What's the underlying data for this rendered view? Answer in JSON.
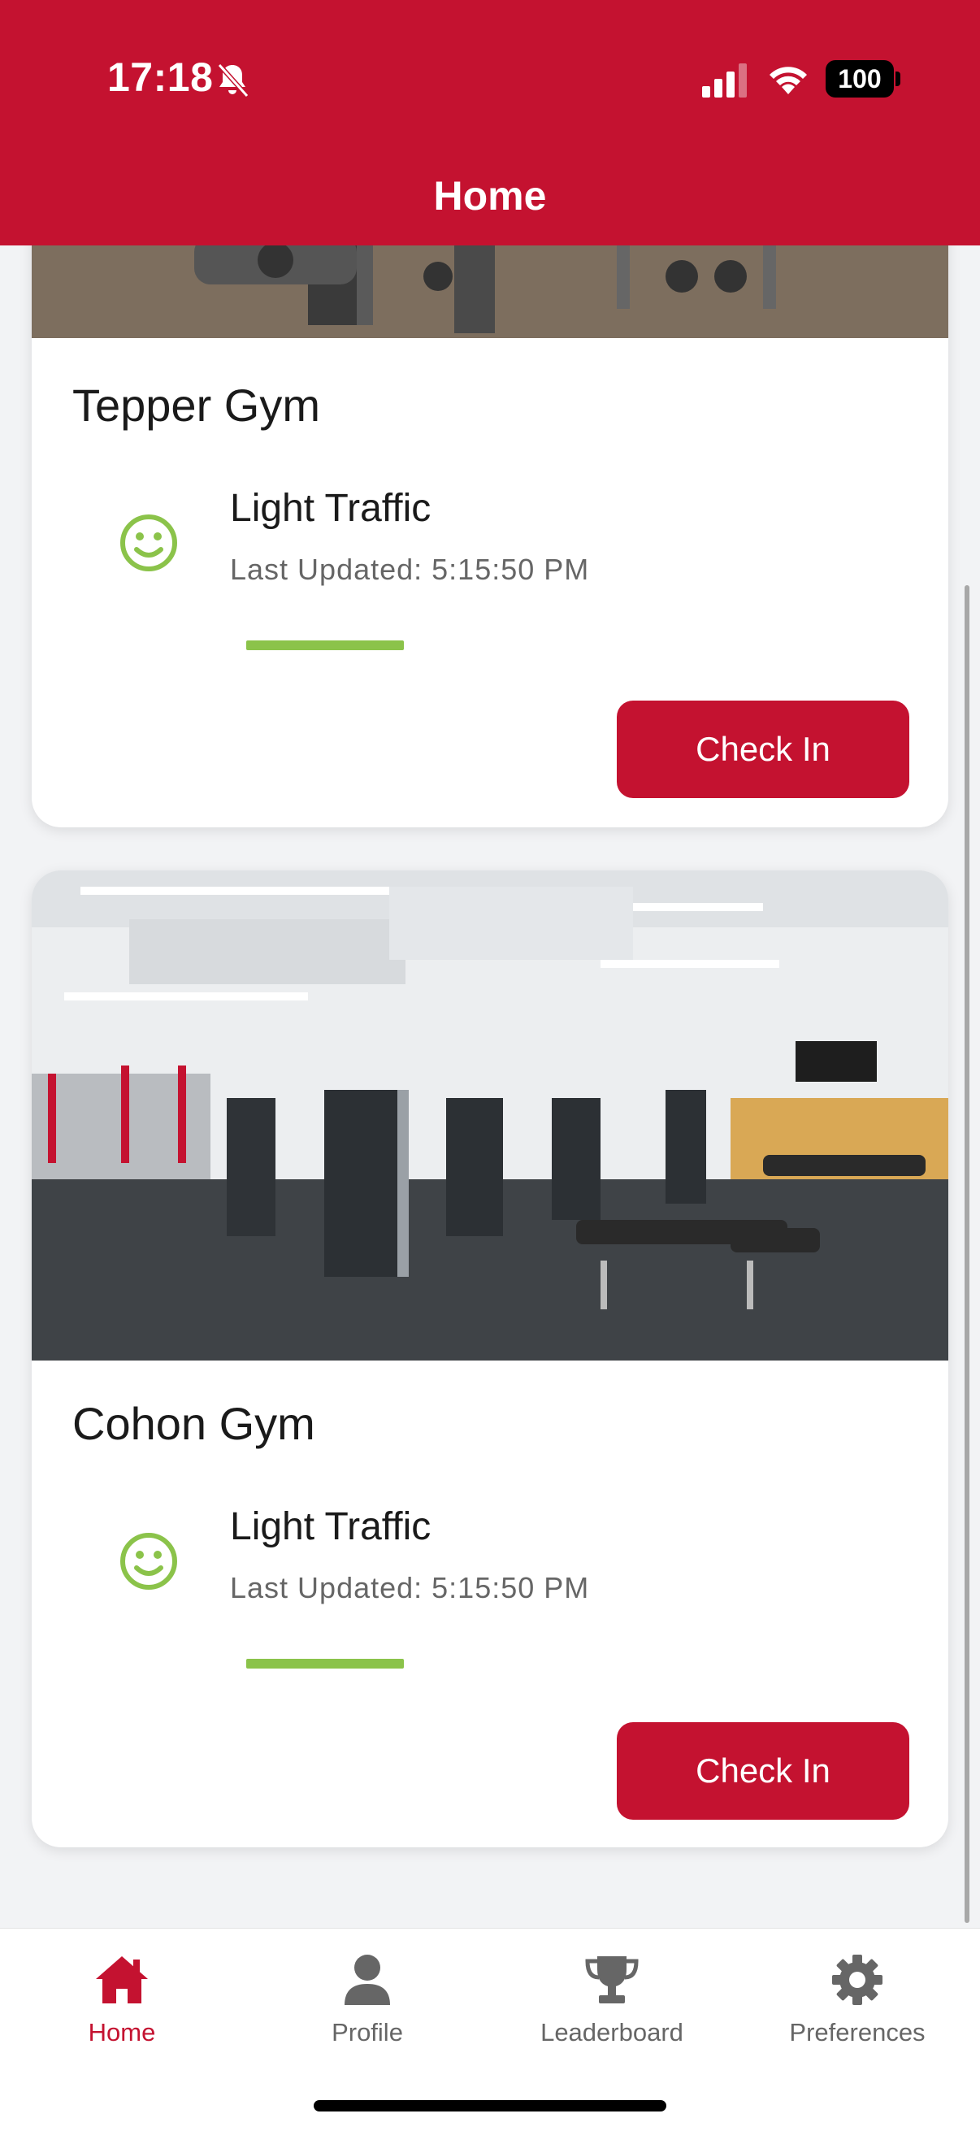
{
  "status_bar": {
    "time": "17:18",
    "battery": "100",
    "icons": [
      "bell-slash-icon",
      "cellular-signal-icon",
      "wifi-icon",
      "battery-icon"
    ]
  },
  "header": {
    "title": "Home",
    "background_color": "#c41230"
  },
  "gyms": [
    {
      "name": "Tepper Gym",
      "traffic_status": "Light Traffic",
      "last_updated": "Last Updated: 5:15:50 PM",
      "traffic_level": 0.33,
      "status_icon": "smile-icon",
      "button_label": "Check In"
    },
    {
      "name": "Cohon Gym",
      "traffic_status": "Light Traffic",
      "last_updated": "Last Updated: 5:15:50 PM",
      "traffic_level": 0.33,
      "status_icon": "smile-icon",
      "button_label": "Check In"
    }
  ],
  "colors": {
    "accent": "#c41230",
    "traffic_light": "#8bc34a",
    "inactive_nav": "#666666"
  },
  "bottom_nav": {
    "items": [
      {
        "label": "Home",
        "icon": "home-icon",
        "active": true
      },
      {
        "label": "Profile",
        "icon": "person-icon",
        "active": false
      },
      {
        "label": "Leaderboard",
        "icon": "trophy-icon",
        "active": false
      },
      {
        "label": "Preferences",
        "icon": "gear-icon",
        "active": false
      }
    ]
  }
}
